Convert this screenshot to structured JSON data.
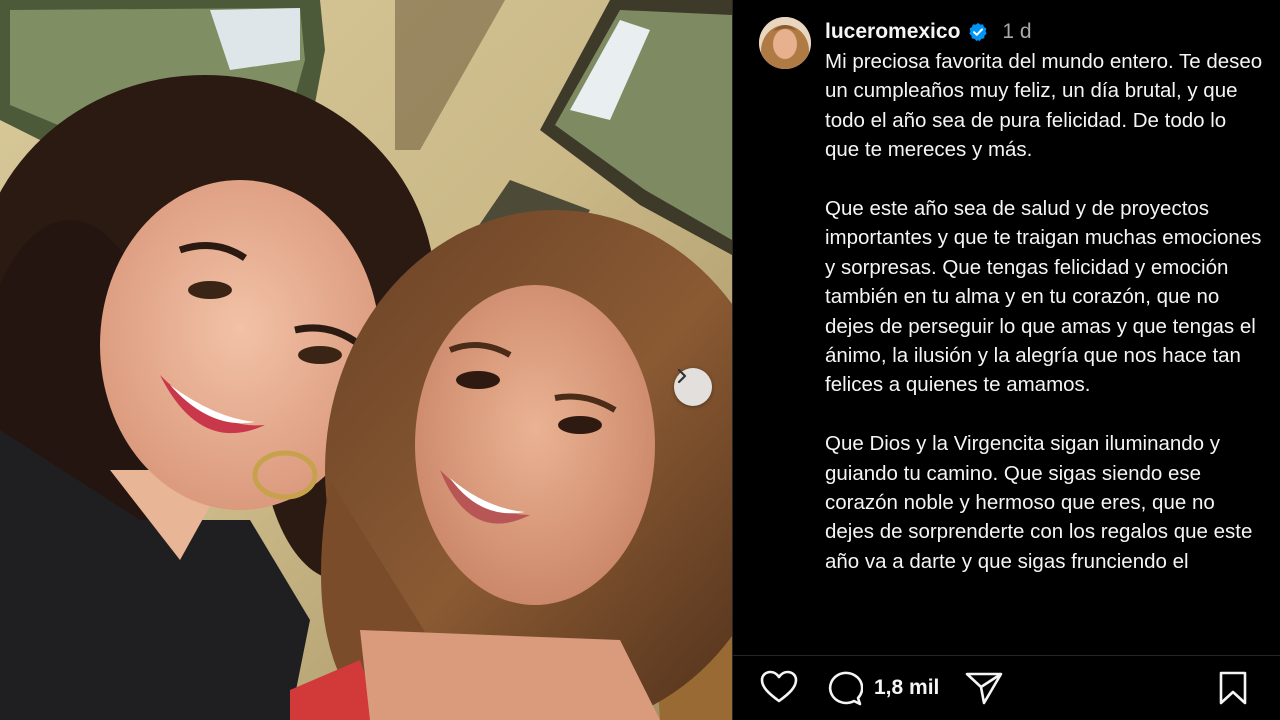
{
  "post": {
    "username": "luceromexico",
    "verified": true,
    "time_ago": "1 d",
    "caption_paragraphs": [
      "Mi preciosa favorita del mundo entero. Te deseo un cumpleaños muy feliz, un día brutal, y que todo el año sea de pura felicidad. De todo lo que te mereces y más.",
      "Que este año sea de salud y de proyectos importantes y que te traigan muchas emociones y sorpresas. Que tengas felicidad y emoción también en tu alma y en tu corazón, que no dejes de perseguir lo que amas y que tengas el ánimo, la ilusión y la alegría que nos hace tan felices a quienes te amamos.",
      "Que Dios y la Virgencita sigan iluminando y guiando tu camino. Que sigas siendo ese corazón noble y hermoso que eres, que no dejes de sorprenderte con los regalos que este año va a darte y que sigas frunciendo el"
    ]
  },
  "actions": {
    "comment_count": "1,8 mil"
  },
  "icons": {
    "next": "chevron-right-icon",
    "like": "heart-icon",
    "comment": "comment-icon",
    "share": "paper-plane-icon",
    "save": "bookmark-icon",
    "verified": "verified-badge-icon"
  },
  "colors": {
    "background": "#000000",
    "text": "#f5f5f5",
    "muted": "#a8a8a8",
    "verified": "#0095f6",
    "divider": "#262626"
  }
}
